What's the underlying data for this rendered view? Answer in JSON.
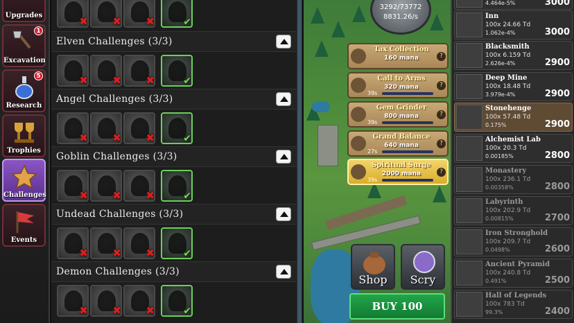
{
  "nav": {
    "items": [
      {
        "label": "Upgrades",
        "badge": "",
        "active": false
      },
      {
        "label": "Excavation",
        "badge": "1",
        "active": false
      },
      {
        "label": "Research",
        "badge": "5",
        "active": false
      },
      {
        "label": "Trophies",
        "badge": "",
        "active": false
      },
      {
        "label": "Challenges",
        "badge": "",
        "active": true
      },
      {
        "label": "Events",
        "badge": "",
        "active": false
      }
    ]
  },
  "challenges": {
    "sections": [
      {
        "title": "Elven Challenges (3/3)",
        "tiles": [
          "failed",
          "failed",
          "failed",
          "done"
        ]
      },
      {
        "title": "Angel Challenges (3/3)",
        "tiles": [
          "failed",
          "failed",
          "failed",
          "done"
        ]
      },
      {
        "title": "Goblin Challenges (3/3)",
        "tiles": [
          "failed",
          "failed",
          "failed",
          "done"
        ]
      },
      {
        "title": "Undead Challenges (3/3)",
        "tiles": [
          "failed",
          "failed",
          "failed",
          "done"
        ]
      },
      {
        "title": "Demon Challenges (3/3)",
        "tiles": [
          "failed",
          "failed",
          "failed",
          "done"
        ]
      }
    ],
    "top_tiles": [
      "failed",
      "failed",
      "failed",
      "done"
    ]
  },
  "mana": {
    "current": "3292/73772",
    "rate": "8831.26/s"
  },
  "spells": [
    {
      "name": "Tax Collection",
      "cost": "160 mana",
      "cooldown": "",
      "active": false
    },
    {
      "name": "Call to Arms",
      "cost": "320 mana",
      "cooldown": "39s",
      "active": false
    },
    {
      "name": "Gem Grinder",
      "cost": "800 mana",
      "cooldown": "39s",
      "active": false
    },
    {
      "name": "Grand Balance",
      "cost": "640 mana",
      "cooldown": "27s",
      "active": false
    },
    {
      "name": "Spiritual Surge",
      "cost": "2000 mana",
      "cooldown": "39s",
      "active": true
    }
  ],
  "shop": {
    "label": "Shop"
  },
  "scry": {
    "label": "Scry"
  },
  "buy": {
    "label": "BUY 100"
  },
  "buildings": [
    {
      "name": "",
      "count": "",
      "pct": "4.464e-5%",
      "cost": "3000",
      "highlight": false,
      "locked": false
    },
    {
      "name": "Inn",
      "count": "100x 24.66 Td",
      "pct": "1.062e-4%",
      "cost": "3000",
      "highlight": false,
      "locked": false
    },
    {
      "name": "Blacksmith",
      "count": "100x 6.159 Td",
      "pct": "2.626e-4%",
      "cost": "2900",
      "highlight": false,
      "locked": false
    },
    {
      "name": "Deep Mine",
      "count": "100x 18.48 Td",
      "pct": "3.979e-4%",
      "cost": "2900",
      "highlight": false,
      "locked": false
    },
    {
      "name": "Stonehenge",
      "count": "100x 57.48 Td",
      "pct": "0.175%",
      "cost": "2900",
      "highlight": true,
      "locked": false
    },
    {
      "name": "Alchemist Lab",
      "count": "100x 20.3 Td",
      "pct": "0.00185%",
      "cost": "2800",
      "highlight": false,
      "locked": false
    },
    {
      "name": "Monastery",
      "count": "100x 236.1 Td",
      "pct": "0.00358%",
      "cost": "2800",
      "highlight": false,
      "locked": true
    },
    {
      "name": "Labyrinth",
      "count": "100x 202.9 Td",
      "pct": "0.00815%",
      "cost": "2700",
      "highlight": false,
      "locked": true
    },
    {
      "name": "Iron Stronghold",
      "count": "100x 209.7 Td",
      "pct": "0.0498%",
      "cost": "2600",
      "highlight": false,
      "locked": true
    },
    {
      "name": "Ancient Pyramid",
      "count": "100x 240.8 Td",
      "pct": "0.491%",
      "cost": "2500",
      "highlight": false,
      "locked": true
    },
    {
      "name": "Hall of Legends",
      "count": "100x 783 Td",
      "pct": "99.3%",
      "cost": "2400",
      "highlight": false,
      "locked": true
    }
  ]
}
